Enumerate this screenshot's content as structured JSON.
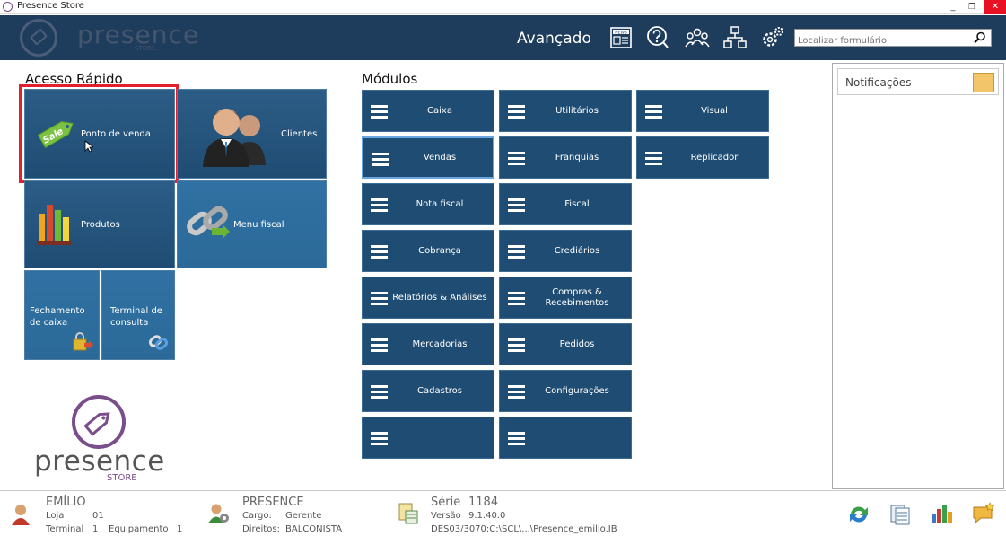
{
  "window": {
    "title": "Presence Store",
    "minimize": "_",
    "restore": "❐",
    "close": "✕"
  },
  "header": {
    "logo_text": "presence",
    "logo_sub": "STORE",
    "mode": "Avançado",
    "icons": [
      "news-icon",
      "help-icon",
      "users-icon",
      "network-icon",
      "settings-icon"
    ],
    "news_label": "NEWS",
    "search_placeholder": "Localizar formulário",
    "accent": "#1e3d5c"
  },
  "quick_access": {
    "title": "Acesso Rápido",
    "sale_tag": "Sale",
    "tiles": [
      {
        "id": "ponto-de-venda",
        "label": "Ponto de venda"
      },
      {
        "id": "clientes",
        "label": "Clientes"
      },
      {
        "id": "produtos",
        "label": "Produtos"
      },
      {
        "id": "menu-fiscal",
        "label": "Menu fiscal"
      },
      {
        "id": "fechamento-de-caixa",
        "label": "Fechamento de caixa"
      },
      {
        "id": "terminal-de-consulta",
        "label": "Terminal de consulta"
      }
    ]
  },
  "modules": {
    "title": "Módulos",
    "items": [
      {
        "label": "Caixa"
      },
      {
        "label": "Utilitários"
      },
      {
        "label": "Visual"
      },
      {
        "label": "Vendas"
      },
      {
        "label": "Franquias"
      },
      {
        "label": "Replicador"
      },
      {
        "label": "Nota fiscal"
      },
      {
        "label": "Fiscal"
      },
      {
        "label": "Cobrança"
      },
      {
        "label": "Crediários"
      },
      {
        "label": "Relatórios & Análises"
      },
      {
        "label": "Compras & Recebimentos"
      },
      {
        "label": "Mercadorias"
      },
      {
        "label": "Pedidos"
      },
      {
        "label": "Cadastros"
      },
      {
        "label": "Configurações"
      }
    ]
  },
  "brand_logo": {
    "text": "presence",
    "sub": "STORE"
  },
  "notifications": {
    "title": "Notificações"
  },
  "status": {
    "user": {
      "name": "EMÍLIO",
      "loja_label": "Loja",
      "loja_value": "01",
      "terminal_label": "Terminal",
      "terminal_value": "1",
      "equip_label": "Equipamento",
      "equip_value": "1"
    },
    "company": {
      "name": "PRESENCE",
      "cargo_label": "Cargo:",
      "cargo_value": "Gerente",
      "direitos_label": "Direitos:",
      "direitos_value": "BALCONISTA"
    },
    "version": {
      "serie_label": "Série",
      "serie_value": "1184",
      "versao_label": "Versão",
      "versao_value": "9.1.40.0",
      "db": "DES03/3070:C:\\SCL\\...\\Presence_emilio.IB"
    }
  }
}
